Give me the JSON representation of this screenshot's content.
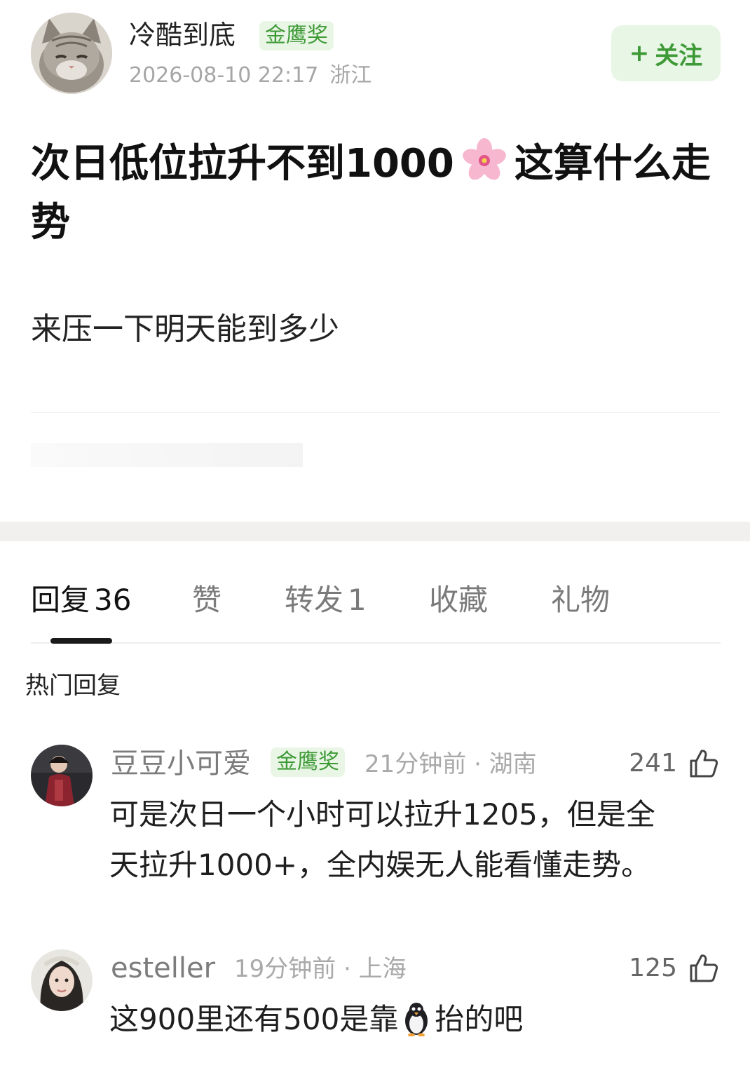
{
  "post": {
    "author": {
      "name": "冷酷到底",
      "badge": "金鹰奖",
      "timestamp": "2026-08-10 22:17",
      "location": "浙江"
    },
    "follow_label": "关注",
    "follow_plus": "+",
    "title_part1": "次日低位拉升不到1000",
    "title_part2": "这算什么走势",
    "body": "来压一下明天能到多少"
  },
  "tabs": [
    {
      "label": "回复",
      "count": "36",
      "active": true
    },
    {
      "label": "赞",
      "count": ""
    },
    {
      "label": "转发",
      "count": "1"
    },
    {
      "label": "收藏",
      "count": ""
    },
    {
      "label": "礼物",
      "count": ""
    }
  ],
  "hot_replies_title": "热门回复",
  "comments": [
    {
      "name": "豆豆小可爱",
      "badge": "金鹰奖",
      "time_location": "21分钟前 · 湖南",
      "likes": "241",
      "text_line1": "可是次日一个小时可以拉升1205，但是全",
      "text_line2": "天拉升1000+，全内娱无人能看懂走势。"
    },
    {
      "name": "esteller",
      "badge": "",
      "time_location": "19分钟前 · 上海",
      "likes": "125",
      "text_part1": "这900里还有500是靠",
      "text_part2": "抬的吧"
    }
  ],
  "icons": {
    "flower": "cherry-blossom-emoji",
    "penguin": "penguin-emoji",
    "like": "thumbs-up-outline-icon"
  },
  "colors": {
    "badge_bg": "#e9f6e6",
    "badge_text": "#3e9a36",
    "meta_gray": "#a6a6a6"
  }
}
